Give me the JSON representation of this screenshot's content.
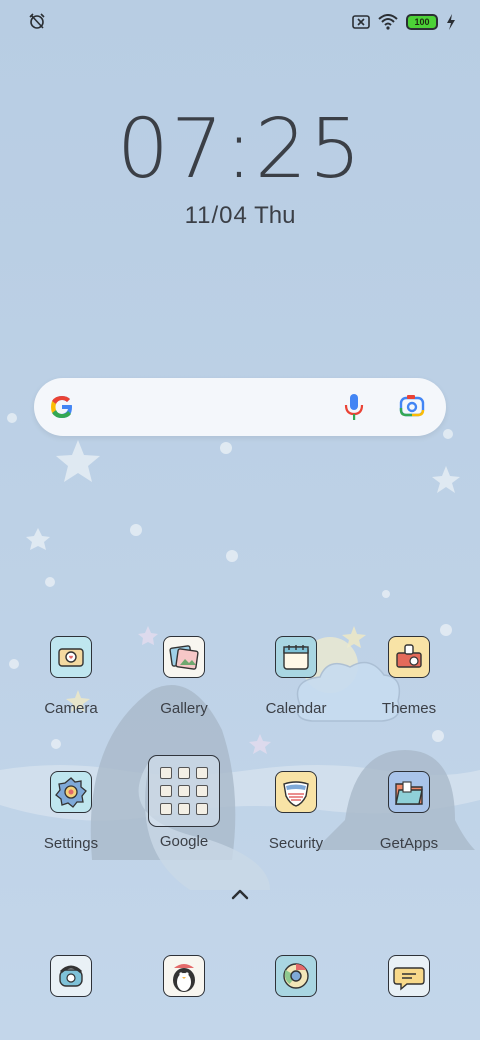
{
  "status_bar": {
    "left_icon": "alarm-off-icon",
    "battery_level": "100",
    "icons": [
      "sim-x-icon",
      "wifi-icon",
      "battery-icon",
      "charging-bolt-icon"
    ]
  },
  "clock": {
    "time": "07:25",
    "date": "11/04",
    "day": "Thu"
  },
  "search": {
    "icons": [
      "google-g-icon",
      "mic-icon",
      "google-lens-icon"
    ]
  },
  "apps": [
    {
      "label": "Camera",
      "icon": "camera-icon"
    },
    {
      "label": "Gallery",
      "icon": "gallery-icon"
    },
    {
      "label": "Calendar",
      "icon": "calendar-icon"
    },
    {
      "label": "Themes",
      "icon": "themes-icon"
    },
    {
      "label": "Settings",
      "icon": "settings-icon"
    },
    {
      "label": "Google",
      "icon": "folder-icon"
    },
    {
      "label": "Security",
      "icon": "security-icon"
    },
    {
      "label": "GetApps",
      "icon": "getapps-icon"
    }
  ],
  "dock": [
    "phone-icon",
    "penguin-icon",
    "chrome-icon",
    "messages-icon"
  ],
  "colors": {
    "background": "#bdd1e6",
    "battery": "#4cd137",
    "text": "#3b3f46"
  }
}
